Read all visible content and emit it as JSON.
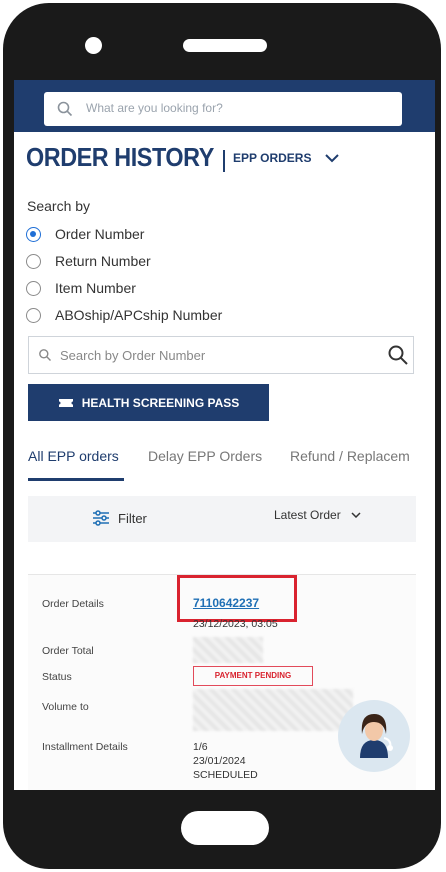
{
  "search": {
    "placeholder": "What are you looking for?"
  },
  "header": {
    "title": "ORDER HISTORY",
    "dropdown_label": "EPP ORDERS"
  },
  "search_by": {
    "label": "Search by",
    "options": [
      {
        "label": "Order Number",
        "selected": true
      },
      {
        "label": "Return Number",
        "selected": false
      },
      {
        "label": "Item Number",
        "selected": false
      },
      {
        "label": "ABOship/APCship Number",
        "selected": false
      }
    ]
  },
  "order_search": {
    "placeholder": "Search by Order Number"
  },
  "pass_button": {
    "label": "HEALTH SCREENING PASS"
  },
  "tabs": [
    {
      "label": "All EPP orders",
      "active": true
    },
    {
      "label": "Delay EPP Orders",
      "active": false
    },
    {
      "label": "Refund / Replacem",
      "active": false
    }
  ],
  "filter": {
    "label": "Filter",
    "sort_label": "Latest Order"
  },
  "order": {
    "details_label": "Order Details",
    "order_number": "7110642237",
    "date": "23/12/2023, 03:05",
    "total_label": "Order Total",
    "status_label": "Status",
    "status_value": "PAYMENT PENDING",
    "volume_label": "Volume to",
    "installment_label": "Installment Details",
    "installment_count": "1/6",
    "installment_date": "23/01/2024",
    "installment_status": "SCHEDULED"
  },
  "colors": {
    "brand": "#1f3d6e",
    "highlight": "#d9232f",
    "link": "#1f6fb5"
  },
  "icons": [
    "search-icon",
    "chevron-down-icon",
    "ticket-icon",
    "filter-icon",
    "support-avatar-icon"
  ]
}
